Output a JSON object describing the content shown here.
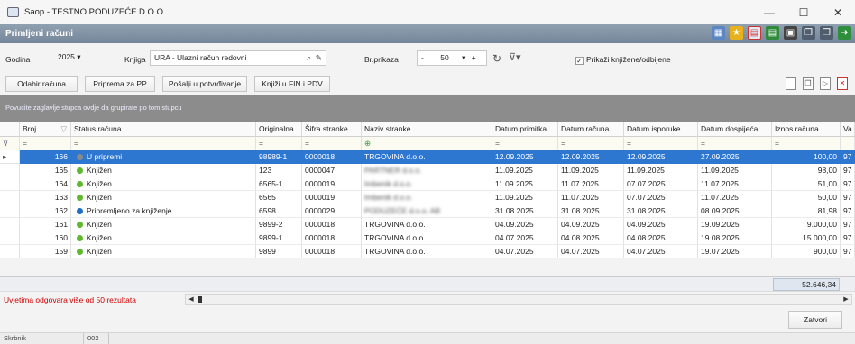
{
  "window": {
    "title": "Saop - TESTNO PODUZEĆE D.O.O.",
    "minimize": "—",
    "maximize": "☐",
    "close": "✕"
  },
  "module": {
    "title": "Primljeni računi"
  },
  "toolbar_icons": [
    "layout-icon",
    "star-icon",
    "pdf-icon",
    "excel-icon",
    "print-icon",
    "copy-icon",
    "paste-icon",
    "exit-icon"
  ],
  "filters": {
    "year_label": "Godina",
    "year_value": "2025",
    "book_label": "Knjiga",
    "book_value": "URA - Ulazni račun redovni",
    "count_label": "Br.prikaza",
    "count_minus": "-",
    "count_value": "50",
    "count_plus": "+",
    "show_checkbox_label": "Prikaži knjižene/odbijene",
    "show_checked": true
  },
  "actions": {
    "select_invoice": "Odabir računa",
    "prepare_pp": "Priprema za PP",
    "send_approval": "Pošalji u potvrđivanje",
    "book_fin": "Knjiži u FIN i PDV"
  },
  "grid": {
    "group_hint": "Povucite zaglavlje stupca ovdje da grupirate po tom stupcu",
    "headers": {
      "broj": "Broj",
      "status": "Status računa",
      "originalna": "Originalna",
      "sifra": "Šifra stranke",
      "naziv": "Naziv stranke",
      "datum_primitka": "Datum primitka",
      "datum_racuna": "Datum računa",
      "datum_isporuke": "Datum isporuke",
      "datum_dospijeca": "Datum dospijeća",
      "iznos": "Iznos računa",
      "val": "Va"
    },
    "filter_symbol": "=",
    "rows": [
      {
        "broj": "166",
        "status": "U pripremi",
        "status_color": "#8a8a8a",
        "orig": "98989-1",
        "sifra": "0000018",
        "naziv": "TRGOVINA d.o.o.",
        "naziv_blur": false,
        "dp": "12.09.2025",
        "dr": "12.09.2025",
        "di": "12.09.2025",
        "dd": "27.09.2025",
        "iznos": "100,00",
        "val": "97"
      },
      {
        "broj": "165",
        "status": "Knjižen",
        "status_color": "#5fb82e",
        "orig": "123",
        "sifra": "0000047",
        "naziv": "PARTNER d.o.o.",
        "naziv_blur": true,
        "dp": "11.09.2025",
        "dr": "11.09.2025",
        "di": "11.09.2025",
        "dd": "11.09.2025",
        "iznos": "98,00",
        "val": "97"
      },
      {
        "broj": "164",
        "status": "Knjižen",
        "status_color": "#5fb82e",
        "orig": "6565-1",
        "sifra": "0000019",
        "naziv": "Imbenik d.o.o.",
        "naziv_blur": true,
        "dp": "11.09.2025",
        "dr": "11.07.2025",
        "di": "07.07.2025",
        "dd": "11.07.2025",
        "iznos": "51,00",
        "val": "97"
      },
      {
        "broj": "163",
        "status": "Knjižen",
        "status_color": "#5fb82e",
        "orig": "6565",
        "sifra": "0000019",
        "naziv": "Imbenik d.o.o.",
        "naziv_blur": true,
        "dp": "11.09.2025",
        "dr": "11.07.2025",
        "di": "07.07.2025",
        "dd": "11.07.2025",
        "iznos": "50,00",
        "val": "97"
      },
      {
        "broj": "162",
        "status": "Pripremljeno za knjiženje",
        "status_color": "#1f6fc4",
        "orig": "6598",
        "sifra": "0000029",
        "naziv": "PODUZEĆE d.o.o. AB",
        "naziv_blur": true,
        "dp": "31.08.2025",
        "dr": "31.08.2025",
        "di": "31.08.2025",
        "dd": "08.09.2025",
        "iznos": "81,98",
        "val": "97"
      },
      {
        "broj": "161",
        "status": "Knjižen",
        "status_color": "#5fb82e",
        "orig": "9899-2",
        "sifra": "0000018",
        "naziv": "TRGOVINA d.o.o.",
        "naziv_blur": false,
        "dp": "04.09.2025",
        "dr": "04.09.2025",
        "di": "04.09.2025",
        "dd": "19.09.2025",
        "iznos": "9.000,00",
        "val": "97"
      },
      {
        "broj": "160",
        "status": "Knjižen",
        "status_color": "#5fb82e",
        "orig": "9899-1",
        "sifra": "0000018",
        "naziv": "TRGOVINA d.o.o.",
        "naziv_blur": false,
        "dp": "04.07.2025",
        "dr": "04.08.2025",
        "di": "04.08.2025",
        "dd": "19.08.2025",
        "iznos": "15.000,00",
        "val": "97"
      },
      {
        "broj": "159",
        "status": "Knjižen",
        "status_color": "#5fb82e",
        "orig": "9899",
        "sifra": "0000018",
        "naziv": "TRGOVINA d.o.o.",
        "naziv_blur": false,
        "dp": "04.07.2025",
        "dr": "04.07.2025",
        "di": "04.07.2025",
        "dd": "19.07.2025",
        "iznos": "900,00",
        "val": "97"
      }
    ],
    "sum_total": "52.646,34"
  },
  "status": {
    "result_message": "Uvjetima odgovara više od 50 rezultata",
    "close_button": "Zatvori",
    "bottom_left": "Skrbnik",
    "bottom_code": "002"
  }
}
